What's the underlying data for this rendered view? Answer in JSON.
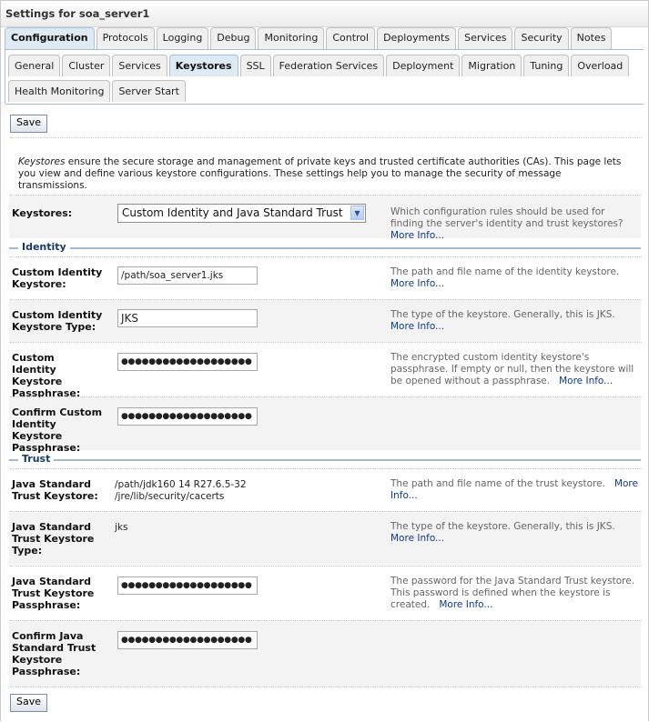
{
  "title": "Settings for soa_server1",
  "main_tabs": [
    {
      "label": "Configuration",
      "active": true
    },
    {
      "label": "Protocols"
    },
    {
      "label": "Logging"
    },
    {
      "label": "Debug"
    },
    {
      "label": "Monitoring"
    },
    {
      "label": "Control"
    },
    {
      "label": "Deployments"
    },
    {
      "label": "Services"
    },
    {
      "label": "Security"
    },
    {
      "label": "Notes"
    }
  ],
  "sub_tabs_row1": [
    {
      "label": "General"
    },
    {
      "label": "Cluster"
    },
    {
      "label": "Services"
    },
    {
      "label": "Keystores",
      "active": true
    },
    {
      "label": "SSL"
    },
    {
      "label": "Federation Services"
    },
    {
      "label": "Deployment"
    },
    {
      "label": "Migration"
    },
    {
      "label": "Tuning"
    },
    {
      "label": "Overload"
    }
  ],
  "sub_tabs_row2": [
    {
      "label": "Health Monitoring"
    },
    {
      "label": "Server Start"
    }
  ],
  "save_label": "Save",
  "intro": {
    "term": "Keystores",
    "text": " ensure the secure storage and management of private keys and trusted certificate authorities (CAs). This page lets you view and define various keystore configurations. These settings help you to manage the security of message transmissions."
  },
  "more_info": "More Info...",
  "keystores": {
    "label": "Keystores:",
    "selected": "Custom Identity and Java Standard Trust",
    "desc": "Which configuration rules should be used for finding the server's identity and trust keystores?"
  },
  "identity": {
    "title": "Identity",
    "fields": [
      {
        "label": "Custom Identity Keystore:",
        "value": "/path/soa_server1.jks",
        "desc": "The path and file name of the identity keystore."
      },
      {
        "label": "Custom Identity Keystore Type:",
        "value": "JKS",
        "desc": "The type of the keystore. Generally, this is JKS."
      },
      {
        "label": "Custom Identity Keystore Passphrase:",
        "value": "●●●●●●●●●●●●●●●●●●●",
        "desc": "The encrypted custom identity keystore's passphrase. If empty or null, then the keystore will be opened without a passphrase."
      },
      {
        "label": "Confirm Custom Identity Keystore Passphrase:",
        "value": "●●●●●●●●●●●●●●●●●●●"
      }
    ]
  },
  "trust": {
    "title": "Trust",
    "fields": [
      {
        "label": "Java Standard Trust Keystore:",
        "value_line1": "/path/jdk160  14  R27.6.5-32",
        "value_line2": "/jre/lib/security/cacerts",
        "desc": "The path and file name of the trust keystore."
      },
      {
        "label": "Java Standard Trust Keystore Type:",
        "value": "jks",
        "desc": "The type of the keystore. Generally, this is JKS."
      },
      {
        "label": "Java Standard Trust Keystore Passphrase:",
        "value": "●●●●●●●●●●●●●●●●●●●",
        "desc": "The password for the Java Standard Trust keystore. This password is defined when the keystore is created."
      },
      {
        "label": "Confirm Java Standard Trust Keystore Passphrase:",
        "value": "●●●●●●●●●●●●●●●●●●●"
      }
    ]
  }
}
